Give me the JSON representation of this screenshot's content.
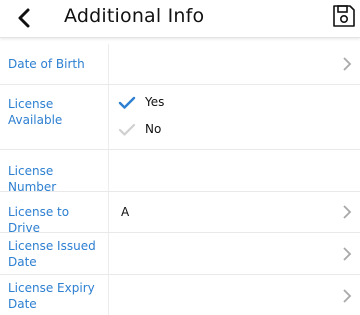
{
  "header": {
    "title": "Additional Info",
    "back_icon": "chevron-left-icon",
    "save_icon": "floppy-disk-icon"
  },
  "fields": {
    "date_of_birth": {
      "label": "Date of Birth",
      "value": ""
    },
    "license_available": {
      "label": "License Available",
      "options": [
        {
          "label": "Yes",
          "checked": true
        },
        {
          "label": "No",
          "checked": false
        }
      ]
    },
    "license_number": {
      "label": "License Number",
      "value": ""
    },
    "license_to_drive": {
      "label": "License to Drive",
      "value": "A"
    },
    "license_issued_date": {
      "label": "License Issued Date",
      "value": ""
    },
    "license_expiry_date": {
      "label": "License Expiry Date",
      "value": ""
    }
  },
  "colors": {
    "label": "#2c7fd1",
    "check_active": "#2c7fd1",
    "check_inactive": "#d0d0d0",
    "chevron": "#a8a8a8"
  }
}
